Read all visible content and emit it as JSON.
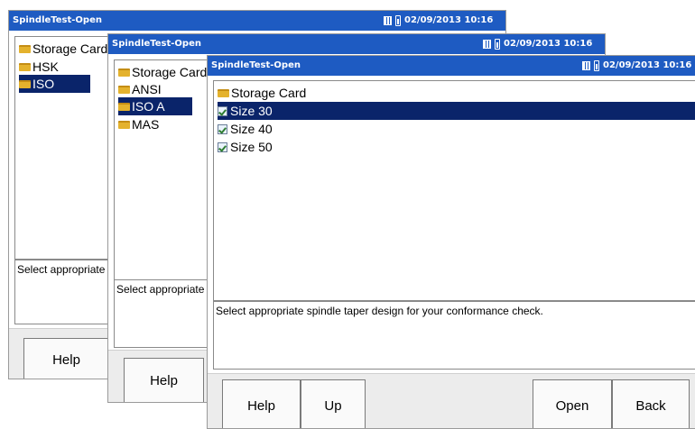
{
  "windows": [
    {
      "title": "SpindleTest-Open",
      "datetime": "02/09/2013 10:16",
      "tree": [
        {
          "label": "Storage Card",
          "icon": "folder-icon",
          "selected": false
        },
        {
          "label": "HSK",
          "icon": "folder-icon",
          "selected": false
        },
        {
          "label": "ISO",
          "icon": "folder-icon",
          "selected": true
        }
      ],
      "description": "Select appropriate spindle taper design for your conformance check.",
      "buttons": [
        "Help"
      ]
    },
    {
      "title": "SpindleTest-Open",
      "datetime": "02/09/2013 10:16",
      "tree": [
        {
          "label": "Storage Card",
          "icon": "folder-icon",
          "selected": false
        },
        {
          "label": "ANSI",
          "icon": "folder-icon",
          "selected": false
        },
        {
          "label": "ISO A",
          "icon": "folder-icon",
          "selected": true
        },
        {
          "label": "MAS",
          "icon": "folder-icon",
          "selected": false
        }
      ],
      "description": "Select appropriate spindle taper design for your conformance check.",
      "buttons": [
        "Help"
      ]
    },
    {
      "title": "SpindleTest-Open",
      "datetime": "02/09/2013 10:16",
      "tree": [
        {
          "label": "Storage Card",
          "icon": "folder-icon",
          "selected": false
        },
        {
          "label": "Size 30",
          "icon": "file-icon",
          "selected": true
        },
        {
          "label": "Size 40",
          "icon": "file-icon",
          "selected": false
        },
        {
          "label": "Size 50",
          "icon": "file-icon",
          "selected": false
        }
      ],
      "description": "Select appropriate spindle taper design for your conformance check.",
      "buttons": [
        "Help",
        "Up",
        "Open",
        "Back"
      ]
    }
  ],
  "colors": {
    "titlebar": "#1e5bc2",
    "selection": "#0a246a",
    "folder": "#e4b22d"
  }
}
